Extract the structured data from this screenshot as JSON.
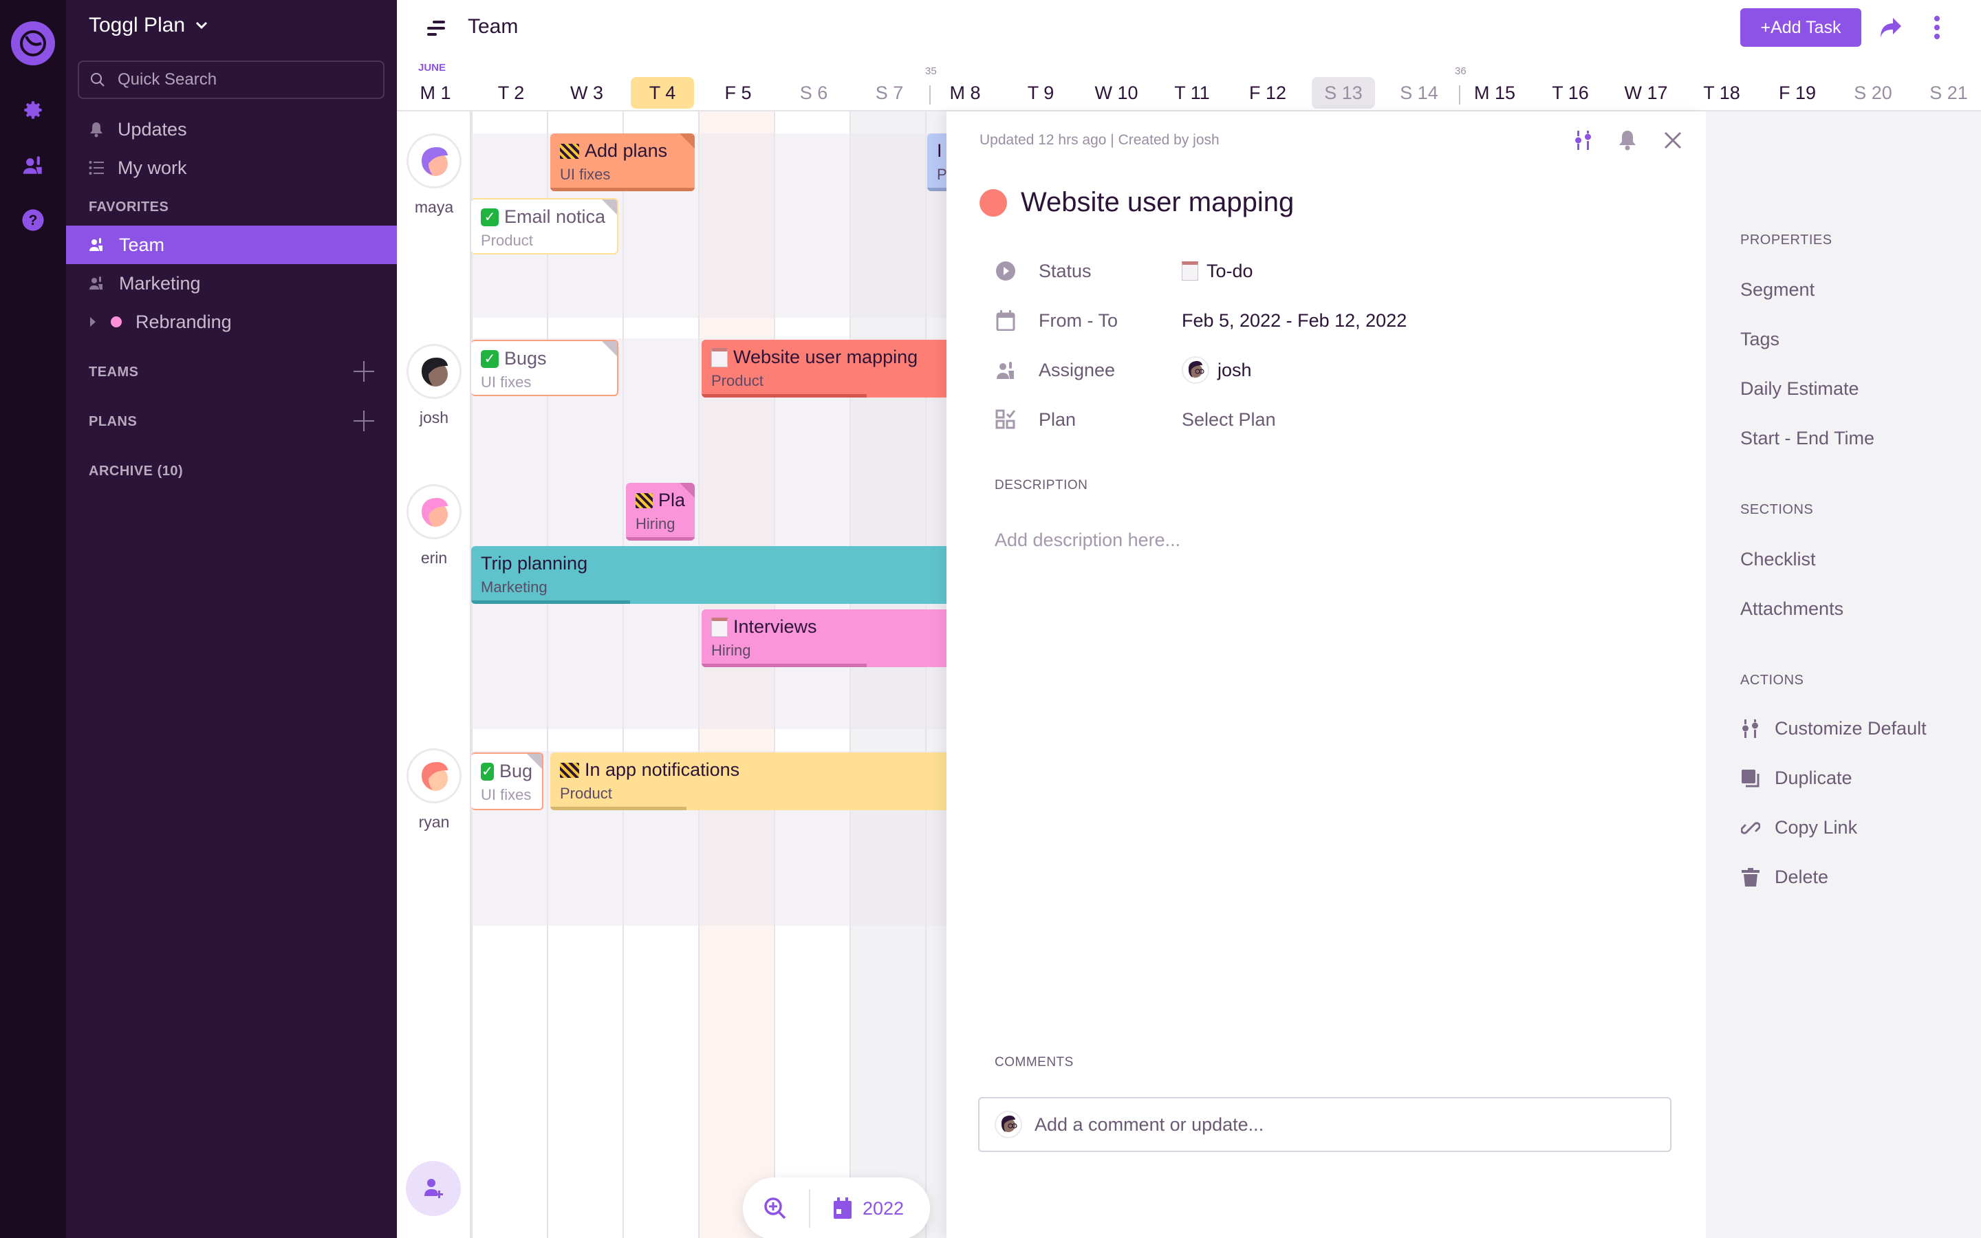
{
  "rail": {
    "icons": [
      "logo-icon",
      "gear-icon",
      "team-icon",
      "help-icon"
    ]
  },
  "sidebar": {
    "workspace": "Toggl Plan",
    "search_placeholder": "Quick Search",
    "nav": [
      {
        "label": "Updates",
        "icon": "bell-icon"
      },
      {
        "label": "My work",
        "icon": "list-icon"
      }
    ],
    "favorites_label": "FAVORITES",
    "favorites": [
      {
        "label": "Team",
        "icon": "team-icon",
        "active": true
      },
      {
        "label": "Marketing",
        "icon": "team-icon",
        "active": false
      },
      {
        "label": "Rebranding",
        "icon": "dot-icon",
        "active": false,
        "dot_color": "#ff8fd8"
      }
    ],
    "teams_label": "TEAMS",
    "plans_label": "PLANS",
    "archive_label": "ARCHIVE (10)"
  },
  "header": {
    "title": "Team",
    "add_task": "+Add Task"
  },
  "timeline": {
    "month": "JUNE",
    "days": [
      {
        "label": "M 1",
        "type": "weekday"
      },
      {
        "label": "T 2",
        "type": "weekday"
      },
      {
        "label": "W 3",
        "type": "weekday"
      },
      {
        "label": "T 4",
        "type": "today"
      },
      {
        "label": "F 5",
        "type": "weekday"
      },
      {
        "label": "S 6",
        "type": "weekend"
      },
      {
        "label": "S 7",
        "type": "weekend"
      },
      {
        "label": "M 8",
        "type": "weekday",
        "week": "35"
      },
      {
        "label": "T 9",
        "type": "weekday"
      },
      {
        "label": "W 10",
        "type": "weekday"
      },
      {
        "label": "T 11",
        "type": "weekday"
      },
      {
        "label": "F 12",
        "type": "weekday"
      },
      {
        "label": "S 13",
        "type": "selected"
      },
      {
        "label": "S 14",
        "type": "weekend"
      },
      {
        "label": "M 15",
        "type": "weekday",
        "week": "36"
      },
      {
        "label": "T 16",
        "type": "weekday"
      },
      {
        "label": "W 17",
        "type": "weekday"
      },
      {
        "label": "T 18",
        "type": "weekday"
      },
      {
        "label": "F 19",
        "type": "weekday"
      },
      {
        "label": "S 20",
        "type": "weekend"
      },
      {
        "label": "S 21",
        "type": "weekend"
      }
    ],
    "people": [
      "maya",
      "josh",
      "erin",
      "ryan"
    ],
    "tasks": [
      {
        "name": "Add plans",
        "plan": "UI fixes",
        "status": "in-progress",
        "color": "#fea07a",
        "person": "maya"
      },
      {
        "name": "Email notica",
        "plan": "Product",
        "status": "done",
        "color": "#fedf93",
        "person": "maya"
      },
      {
        "name": "I",
        "plan": "P",
        "status": "",
        "color": "#b8c8f4",
        "person": "maya"
      },
      {
        "name": "Bugs",
        "plan": "UI fixes",
        "status": "done",
        "color": "#fea07a",
        "person": "josh"
      },
      {
        "name": "Website user mapping",
        "plan": "Product",
        "status": "to-do",
        "color": "#fd7e74",
        "person": "josh"
      },
      {
        "name": "Pla",
        "plan": "Hiring",
        "status": "in-progress",
        "color": "#fb95d9",
        "person": "erin"
      },
      {
        "name": "Trip planning",
        "plan": "Marketing",
        "status": "",
        "color": "#5fc3cc",
        "person": "erin"
      },
      {
        "name": "Interviews",
        "plan": "Hiring",
        "status": "to-do",
        "color": "#fb95d9",
        "person": "erin"
      },
      {
        "name": "Bug",
        "plan": "UI fixes",
        "status": "done",
        "color": "#fea07a",
        "person": "ryan"
      },
      {
        "name": "In app notifications",
        "plan": "Product",
        "status": "in-progress",
        "color": "#fedf93",
        "person": "ryan"
      }
    ],
    "year": "2022"
  },
  "detail": {
    "meta": "Updated 12 hrs ago | Created by josh",
    "title": "Website user mapping",
    "title_color": "#fd7e74",
    "properties": [
      {
        "label": "Status",
        "value": "To-do",
        "icon": "status-icon"
      },
      {
        "label": "From - To",
        "value": "Feb 5, 2022 - Feb 12, 2022",
        "icon": "calendar-icon"
      },
      {
        "label": "Assignee",
        "value": "josh",
        "icon": "assignee-icon"
      },
      {
        "label": "Plan",
        "value": "Select Plan",
        "icon": "plan-icon"
      }
    ],
    "description_label": "DESCRIPTION",
    "description_placeholder": "Add description here...",
    "comments_label": "COMMENTS",
    "comment_placeholder": "Add a comment or update..."
  },
  "right_panel": {
    "properties_label": "PROPERTIES",
    "properties": [
      "Segment",
      "Tags",
      "Daily Estimate",
      "Start - End Time"
    ],
    "sections_label": "SECTIONS",
    "sections": [
      "Checklist",
      "Attachments"
    ],
    "actions_label": "ACTIONS",
    "actions": [
      {
        "label": "Customize Default",
        "icon": "sliders-icon"
      },
      {
        "label": "Duplicate",
        "icon": "duplicate-icon"
      },
      {
        "label": "Copy Link",
        "icon": "link-icon"
      },
      {
        "label": "Delete",
        "icon": "trash-icon"
      }
    ]
  },
  "colors": {
    "accent": "#8d52e6",
    "sidebar_bg": "#2c1338",
    "rail_bg": "#1b0b21",
    "today": "#fedf93"
  }
}
